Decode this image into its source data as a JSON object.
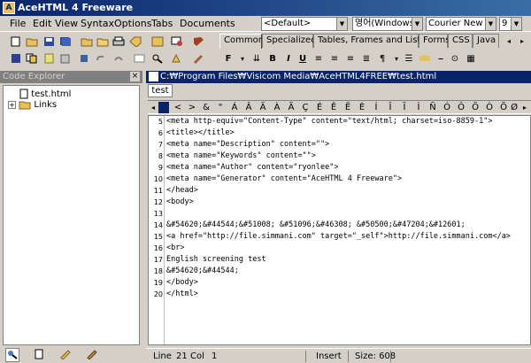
{
  "window": {
    "title": "AceHTML 4 Freeware"
  },
  "menu": [
    "File",
    "Edit",
    "View",
    "Syntax",
    "Options",
    "Tabs",
    "Documents"
  ],
  "combos": {
    "style": "<Default>",
    "charset": "영어(Windows)",
    "font": "Courier New",
    "size": "9"
  },
  "toolbar_tabs": [
    "Common",
    "Specialized",
    "Tables, Frames and Lists",
    "Forms",
    "CSS",
    "Java"
  ],
  "explorer": {
    "title": "Code Explorer",
    "items": [
      "test.html",
      "Links"
    ]
  },
  "editor": {
    "title": "C:₩Program Files₩Visicom Media₩AceHTML4FREE₩test.html",
    "doc_tab": "test",
    "entities": [
      "",
      "<",
      ">",
      "&",
      "\"",
      "Á",
      "Â",
      "Ä",
      "À",
      "Ã",
      "Ç",
      "É",
      "Ê",
      "Ë",
      "È",
      "Í",
      "Î",
      "Ï",
      "Ì",
      "Ñ",
      "Ó",
      "Ô",
      "Ö",
      "Ò",
      "Õ",
      "Ø"
    ],
    "lines": [
      {
        "n": "5",
        "t": "<meta http-equiv=\"Content-Type\" content=\"text/html; charset=iso-8859-1\">"
      },
      {
        "n": "6",
        "t": "<title></title>"
      },
      {
        "n": "7",
        "t": "<meta name=\"Description\" content=\"\">"
      },
      {
        "n": "8",
        "t": "<meta name=\"Keywords\" content=\"\">"
      },
      {
        "n": "9",
        "t": "<meta name=\"Author\" content=\"ryonlee\">"
      },
      {
        "n": "10",
        "t": "<meta name=\"Generator\" content=\"AceHTML 4 Freeware\">"
      },
      {
        "n": "11",
        "t": "</head>"
      },
      {
        "n": "12",
        "t": "<body>"
      },
      {
        "n": "13",
        "t": ""
      },
      {
        "n": "14",
        "t": "&#54620;&#44544;&#51008; &#51096;&#46308; &#50500;&#47204;&#12601;"
      },
      {
        "n": "15",
        "t": "<a href=\"http://file.simmani.com\" target=\"_self\">http://file.simmani.com</a>"
      },
      {
        "n": "16",
        "t": "<br>"
      },
      {
        "n": "17",
        "t": "English screening test"
      },
      {
        "n": "18",
        "t": "&#54620;&#44544;"
      },
      {
        "n": "19",
        "t": "</body>"
      },
      {
        "n": "20",
        "t": "</html>"
      }
    ]
  },
  "status": {
    "line_label": "Line",
    "line": "21",
    "col_label": "Col",
    "col": "1",
    "mode": "Insert",
    "size": "Size: 608"
  }
}
